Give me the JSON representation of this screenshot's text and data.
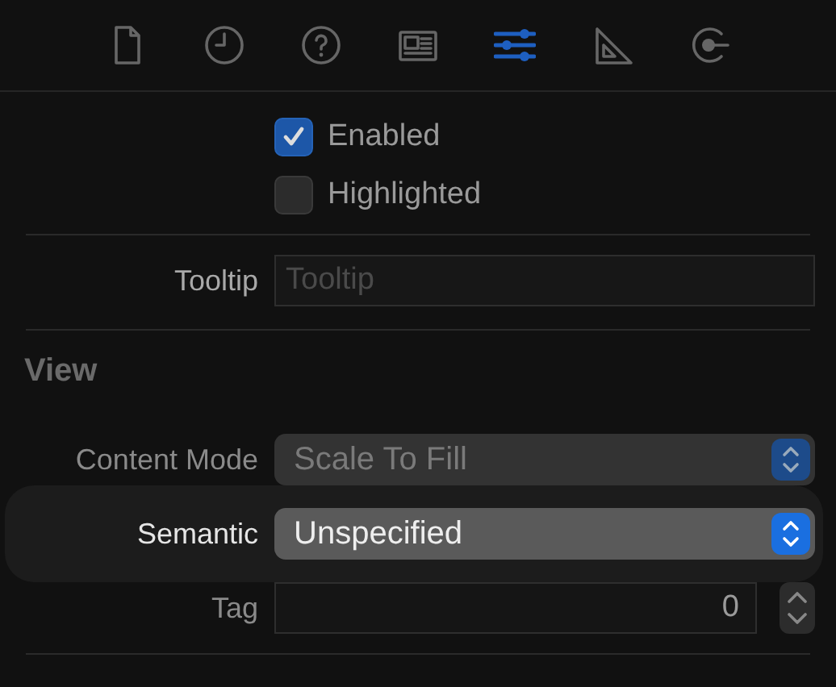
{
  "toolbar": [
    {
      "kind": "file",
      "selected": false
    },
    {
      "kind": "history",
      "selected": false
    },
    {
      "kind": "help",
      "selected": false
    },
    {
      "kind": "identity",
      "selected": false
    },
    {
      "kind": "attributes",
      "selected": true
    },
    {
      "kind": "size",
      "selected": false
    },
    {
      "kind": "connections",
      "selected": false
    }
  ],
  "checkboxes": [
    {
      "label": "Enabled",
      "checked": true
    },
    {
      "label": "Highlighted",
      "checked": false
    }
  ],
  "tooltip": {
    "label": "Tooltip",
    "placeholder": "Tooltip"
  },
  "section": "View",
  "popups": [
    {
      "label": "Content Mode",
      "value": "Scale To Fill",
      "highlighted": false
    },
    {
      "label": "Semantic",
      "value": "Unspecified",
      "highlighted": true
    }
  ],
  "tag": {
    "label": "Tag",
    "value": "0"
  }
}
